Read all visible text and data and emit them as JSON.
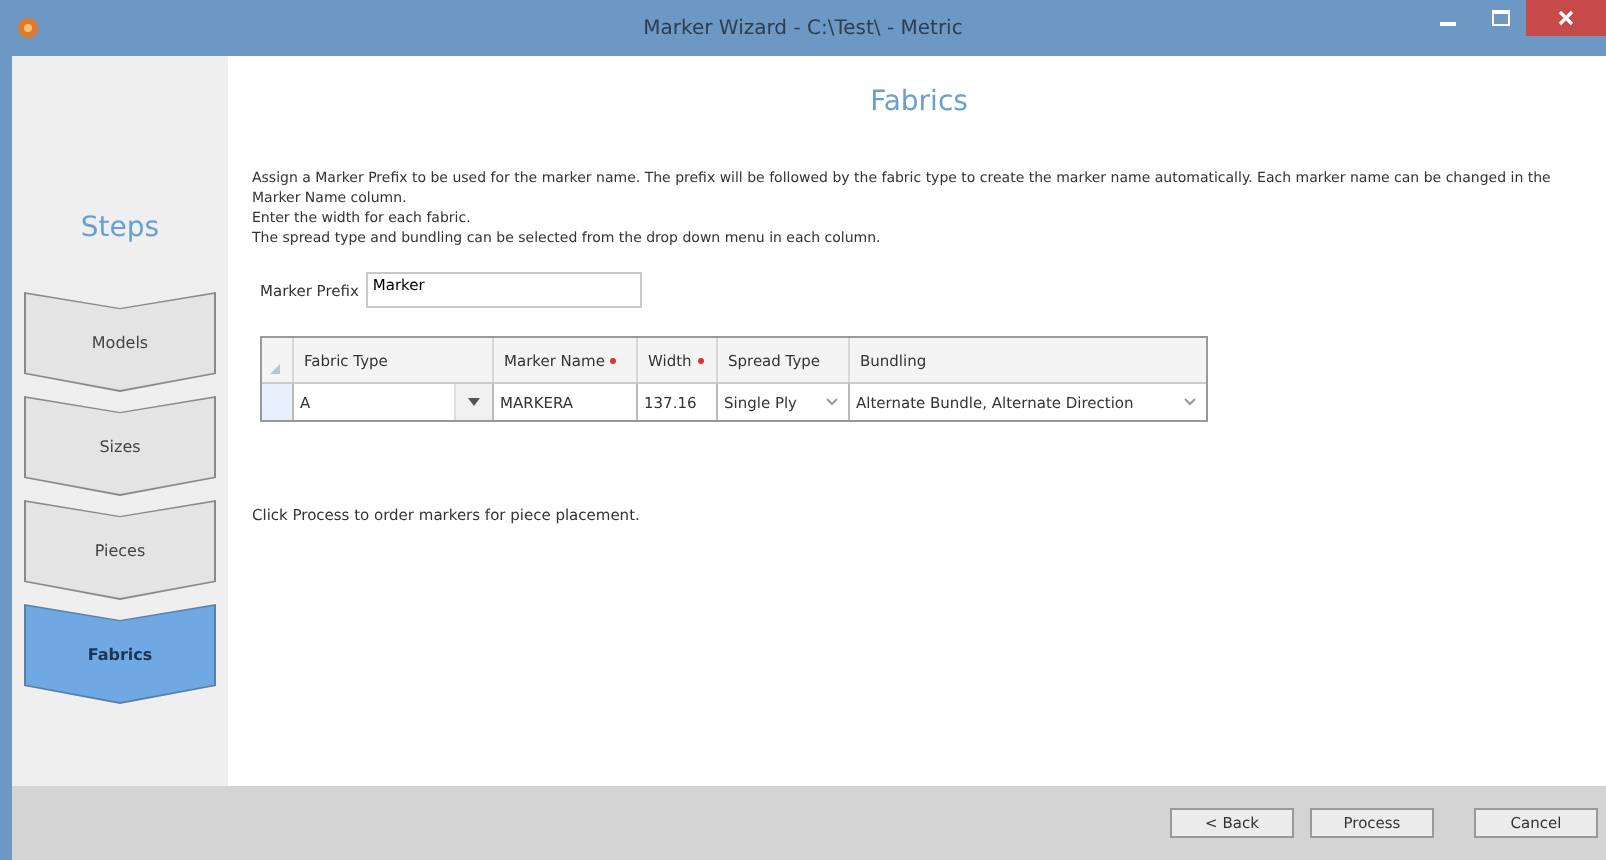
{
  "window": {
    "title": "Marker Wizard - C:\\Test\\ - Metric"
  },
  "sidebar": {
    "title": "Steps",
    "steps": [
      {
        "label": "Models",
        "selected": false
      },
      {
        "label": "Sizes",
        "selected": false
      },
      {
        "label": "Pieces",
        "selected": false
      },
      {
        "label": "Fabrics",
        "selected": true
      }
    ]
  },
  "page": {
    "title": "Fabrics",
    "instructions": [
      "Assign a Marker Prefix to be used for the marker name. The prefix will be followed by the fabric type to create the marker name automatically. Each marker name can be changed in the Marker Name column.",
      "Enter the width for each fabric.",
      "The spread type and bundling can be selected from the drop down menu in each column."
    ],
    "marker_prefix": {
      "label": "Marker Prefix",
      "value": "Marker"
    },
    "table": {
      "columns": [
        {
          "label": "Fabric Type",
          "required": false
        },
        {
          "label": "Marker Name",
          "required": true
        },
        {
          "label": "Width",
          "required": true
        },
        {
          "label": "Spread Type",
          "required": false
        },
        {
          "label": "Bundling",
          "required": false
        }
      ],
      "rows": [
        {
          "cells": [
            {
              "kind": "combo",
              "value": "A"
            },
            {
              "kind": "text",
              "value": "MARKERA"
            },
            {
              "kind": "text",
              "value": "137.16"
            },
            {
              "kind": "select",
              "value": "Single Ply"
            },
            {
              "kind": "select",
              "value": "Alternate Bundle, Alternate Direction"
            }
          ]
        }
      ]
    },
    "note": "Click Process to order markers for piece placement."
  },
  "buttons": [
    "< Back",
    "Process",
    "Cancel"
  ]
}
